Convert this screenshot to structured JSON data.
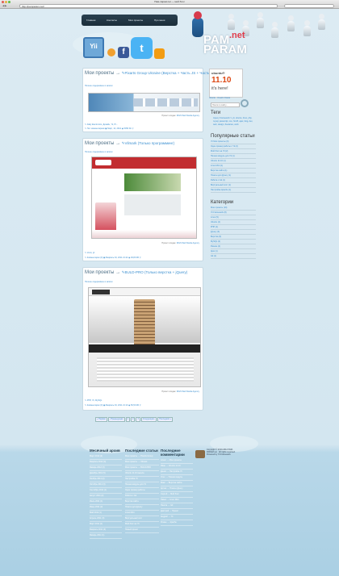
{
  "browser": {
    "title": "Пам-парам.net — мой блог",
    "url": "http://pamparam.net/",
    "nav": "◀ ▶"
  },
  "menu": [
    "Главная",
    "Контакты",
    "Мои проекты",
    "Про меня"
  ],
  "logo": {
    "text": "PAM PARAM",
    "net": ".net"
  },
  "icons": [
    "yii-blog-icon",
    "rss-icon",
    "facebook-icon",
    "twitter-icon",
    "rss-feed-icon"
  ],
  "posts": [
    {
      "heading": "Мои проекты →",
      "link": "✎Pixarts Group Ukraine (Верстка + Часть JS + Часть Бекенда'a)",
      "read_more": "Полное содержимое в записи",
      "by": "Проект создан: ",
      "by_link": "DIGS Web Media Agency",
      "meta": [
        "✎ Daily Electronics, Дизайн, Yii, PI...",
        "✎ Нет комментариев  ▣ Март, 12, 2012  ◉ 5056 Kb  ⚲"
      ]
    },
    {
      "heading": "Мои проекты →",
      "link": "✎Vilmark (Только программинг)",
      "read_more": "Полное содержимое в записи",
      "by": "Проект создан: ",
      "by_link": "DIGS Web Media Agency",
      "meta": [
        "✎ Verst, yii",
        "✎ Комментарии (0)  ▣ Февраль 04, 2011 21:42  ◉ 49,80 КБ  ⚲"
      ]
    },
    {
      "heading": "Мои проекты →",
      "link": "✎BULD-PRO (Только верстка + jQuery)",
      "read_more": "Полное содержимое в записи",
      "by": "Проект создан: ",
      "by_link": "DIGS Web Media Agency",
      "meta": [
        "✎ PHP, Yii, MySQL",
        "✎ Комментарии (0)  ▣ Февраль 04, 2011 21:10  ◉ 50,50 КБ  ⚲"
      ]
    }
  ],
  "ubuntu": {
    "brand": "ubuntu®",
    "version": "11.10",
    "slogan": "it's here!",
    "caption": "Ubuntu · Oneiric Ocelot"
  },
  "sidebar": {
    "search_placeholder": "Поиск по сайту...",
    "tags_title": "Теги",
    "tags_text": "Jquery Framework ✎ yii, ubuntu, linux, php, mysql, javascript, css, html5, ajax, blog, dev, web, design, freelance, work",
    "popular_title": "Популярные статьи",
    "popular": [
      "Yii Мои проекты (3)",
      "Один пример работы с Yii (2)",
      "Мой блог на Yii (2)",
      "Пишем модуль для Yii (1)",
      "Ubuntu 11.10 (1)",
      "Linux Mint (1)",
      "Верстка сайта (1)",
      "Плагин для jQuery (1)",
      "Работа с Git (1)",
      "Виртуальный хост (1)",
      "Настройка Apache (1)",
      "Новый проект (1)"
    ],
    "cat_title": "Категории",
    "cats": [
      "Мои проекты (10)",
      "Yii Framework (8)",
      "Linux (5)",
      "Ubuntu (4)",
      "PHP (4)",
      "jQuery (3)",
      "Верстка (3)",
      "MySQL (2)",
      "Разное (2)",
      "Ajax (1)",
      "Git (1)",
      "Блог (1)"
    ]
  },
  "pager": [
    "« Первая",
    "‹ Предыдущая",
    "1",
    "2",
    "3",
    "Следующая ›",
    "Последняя »"
  ],
  "footer": {
    "archive_title": "Месячный архив",
    "archive": [
      "Март 2012 (2)",
      "Февраль 2012 (4)",
      "Январь 2012 (3)",
      "Декабрь 2011 (5)",
      "Ноябрь 2011 (2)",
      "Октябрь 2011 (3)",
      "Сентябрь 2011 (1)",
      "Август 2011 (2)",
      "Июль 2011 (1)",
      "Июнь 2011 (2)",
      "Май 2011 (1)",
      "Апрель 2011 (3)",
      "Март 2011 (2)",
      "Февраль 2011 (4)",
      "Январь 2011 (1)",
      "Декабрь 2010 (2)"
    ],
    "recent_title": "Последние статьи",
    "recent": [
      "Мои проекты → Pixarts Group",
      "Мои проекты → Vilmark",
      "Мои проекты → BULD-PRO",
      "Ubuntu 11.10 вышла",
      "Настройка Yii",
      "Пишем модуль для Yii",
      "Один пример работы",
      "Работа с Git",
      "Верстка сайта",
      "Плагин для jQuery",
      "Linux Mint",
      "Виртуальный хост",
      "Мой блог на Yii",
      "Новый проект"
    ],
    "comments_title": "Последние комментарии",
    "comments": [
      "Алекс → Мои проекты",
      "Иван → Ubuntu 11.10",
      "Денис → Настройка Yii",
      "Олег → Пишем модуль",
      "Макс → Верстка сайта",
      "Артем → Плагин jQuery",
      "Сергей → Мой блог",
      "Павел → Linux Mint",
      "Никита → Git",
      "Дмитрий → Проект",
      "Андрей → Yii",
      "Роман → Apache"
    ],
    "copyright": "Copyright © 2010-2012 PAM-PARAM.net · All rights reserved. Powered by Yii Framework"
  }
}
